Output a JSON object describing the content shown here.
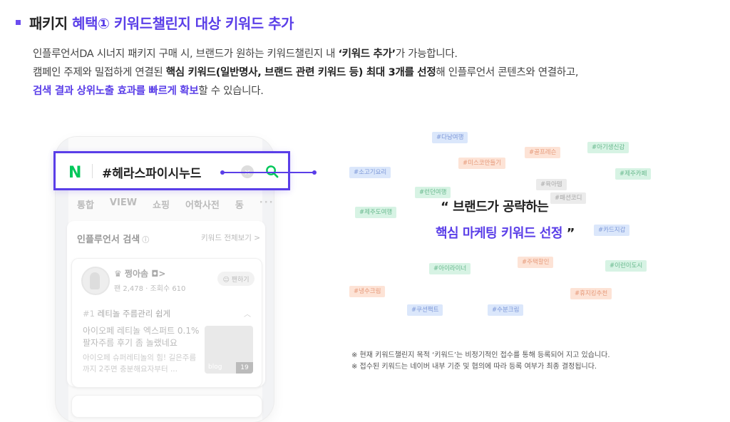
{
  "heading": {
    "prefix": "패키지 ",
    "accent": "혜택① 키워드챌린지 대상 키워드 추가"
  },
  "description": {
    "l1a": "인플루언서DA 시너지 패키지 구매 시, 브랜드가 원하는 키워드챌린지 내 ",
    "l1b": "‘키워드 추가’",
    "l1c": "가 가능합니다.",
    "l2a": "캠페인 주제와 밀접하게 연결된 ",
    "l2b": "핵심 키워드(일반명사, 브랜드 관련 키워드 등) 최대 3개를 선정",
    "l2c": "해 인플루언서 콘텐츠와 연결하고,",
    "l3a": "검색 결과 상위노출 효과를 빠르게 확보",
    "l3b": "할 수 있습니다."
  },
  "search": {
    "logo": "N",
    "query": "#헤라스파이시누드",
    "clear": "×"
  },
  "phone": {
    "tabs": [
      "통합",
      "VIEW",
      "쇼핑",
      "어학사전",
      "동",
      "···"
    ],
    "inf_title": "인플루언서 검색",
    "inf_info": "ⓘ",
    "inf_all": "키워드 전체보기 >",
    "profile_name": "♛ 쩡아솜 ◘>",
    "profile_stats": "팬 2,478 · 조회수 610",
    "follow": "☺ 팬하기",
    "post_tag_num": "#1",
    "post_tag": " 레티놀 주름관리 쉽게",
    "post_chevron": "︿",
    "post_body1": "아이오페 레티놀 엑스퍼트 0.1% 팔자주름 후기 좀 놀랬네요",
    "post_body2": "아이오페 슈퍼레티놀의 힘! 길은주름까지 2주면 충분해요자부터 ...",
    "thumb_label": "blog",
    "thumb_count": "19"
  },
  "tags": [
    "#다낭여행",
    "#골프레슨",
    "#아기생신감",
    "#미스코만들기",
    "#소고기요리",
    "#육아템",
    "#제주카페",
    "#런던여행",
    "#패션코디",
    "#제주도여행",
    "#카드지갑",
    "#아이라이너",
    "#주택할인",
    "#이런이도시",
    "#냉수크림",
    "#휴지킹추천",
    "#쿠션팩트",
    "#수분크림"
  ],
  "quote": {
    "line1": "“ 브랜드가 공략하는",
    "line2": "핵심 마케팅 키워드 선정",
    "close": " ”"
  },
  "notes": [
    "※ 현재 키워드챌린지 목적 ‘키워드’는 비정기적인 접수를 통해 등록되어 지고 있습니다.",
    "※ 접수된 키워드는 네이버 내부 기준 및 협의에 따라 등록 여부가 최종 결정됩니다."
  ],
  "colors": {
    "accent": "#5a3ee8",
    "naver_green": "#03c75a"
  }
}
